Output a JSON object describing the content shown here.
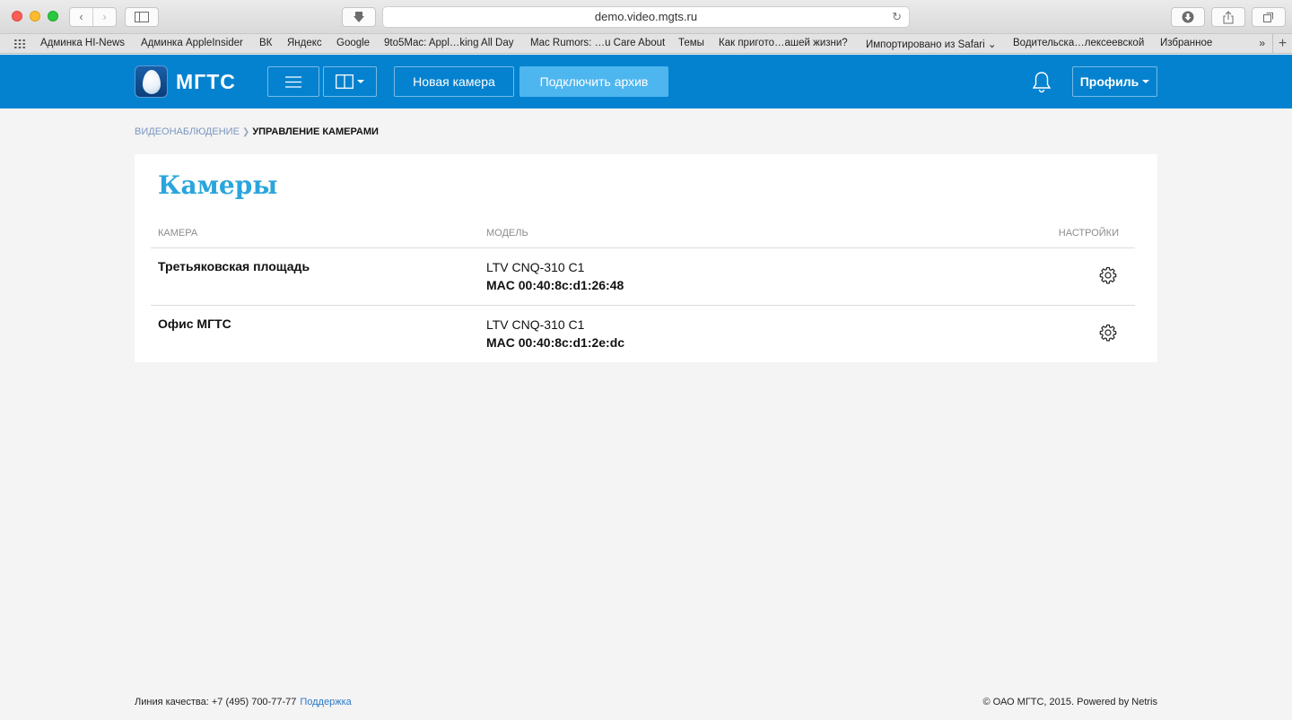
{
  "browser": {
    "url": "demo.video.mgts.ru",
    "bookmarks": [
      "Админка HI-News",
      "Админка AppleInsider",
      "ВК",
      "Яндекс",
      "Google",
      "9to5Mac: Appl…king All Day",
      "Mac Rumors: …u Care About",
      "Темы",
      "Как пригото…ашей жизни?",
      "Импортировано из Safari",
      "Водительска…лексеевской",
      "Избранное"
    ],
    "more_label": "»",
    "add_label": "+"
  },
  "header": {
    "logo_text": "МГТС",
    "new_camera_label": "Новая камера",
    "archive_label": "Подключить архив",
    "profile_label": "Профиль"
  },
  "breadcrumb": {
    "parent": "Видеонаблюдение",
    "current": "Управление камерами"
  },
  "cameras": {
    "title": "Камеры",
    "columns": {
      "camera": "Камера",
      "model": "Модель",
      "settings": "Настройки"
    },
    "rows": [
      {
        "name": "Третьяковская площадь",
        "model": "LTV CNQ-310 C1",
        "mac": "MAC 00:40:8c:d1:26:48"
      },
      {
        "name": "Офис МГТС",
        "model": "LTV CNQ-310 C1",
        "mac": "MAC 00:40:8c:d1:2e:dc"
      }
    ]
  },
  "footer": {
    "hotline": "Линия качества: +7 (495) 700-77-77",
    "support": "Поддержка",
    "copyright": "© ОАО МГТС, 2015. Powered by Netris"
  },
  "colors": {
    "header_bg": "#0582cf",
    "accent": "#2aa5dc",
    "archive_button": "#4db6ef",
    "link": "#7b96c1"
  },
  "icons": [
    "menu-icon",
    "layout-icon",
    "bell-icon",
    "gear-icon",
    "download-icon",
    "reload-icon",
    "sidebar-icon",
    "share-icon",
    "tabs-icon"
  ]
}
